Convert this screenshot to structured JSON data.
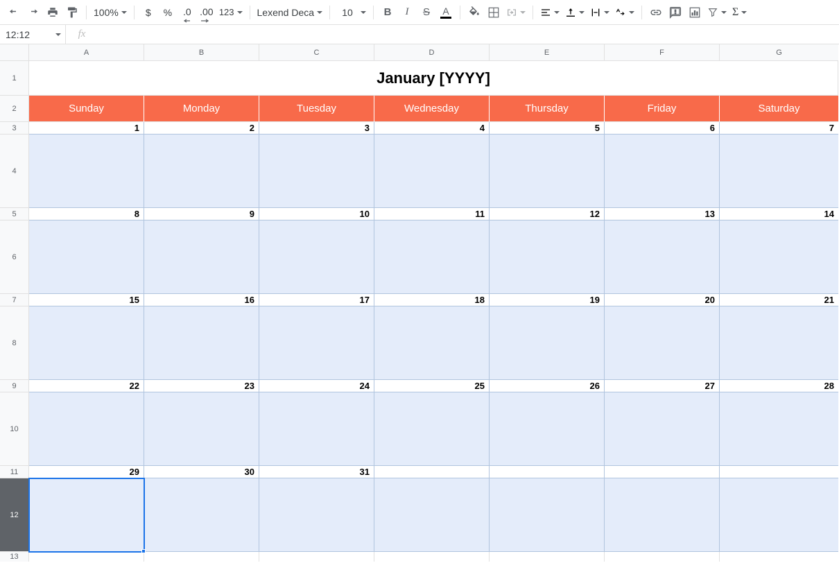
{
  "toolbar": {
    "zoom": "100%",
    "currency": "$",
    "percent": "%",
    "dec_dec": ".0",
    "inc_dec": ".00",
    "num_fmt": "123",
    "font": "Lexend Deca",
    "font_size": "10"
  },
  "namebox": "12:12",
  "fx": "fx",
  "columns": [
    "A",
    "B",
    "C",
    "D",
    "E",
    "F",
    "G"
  ],
  "row_numbers": [
    "1",
    "2",
    "3",
    "4",
    "5",
    "6",
    "7",
    "8",
    "9",
    "10",
    "11",
    "12",
    "13"
  ],
  "title": "January [YYYY]",
  "day_names": [
    "Sunday",
    "Monday",
    "Tuesday",
    "Wednesday",
    "Thursday",
    "Friday",
    "Saturday"
  ],
  "weeks": [
    {
      "dates": [
        "1",
        "2",
        "3",
        "4",
        "5",
        "6",
        "7"
      ]
    },
    {
      "dates": [
        "8",
        "9",
        "10",
        "11",
        "12",
        "13",
        "14"
      ]
    },
    {
      "dates": [
        "15",
        "16",
        "17",
        "18",
        "19",
        "20",
        "21"
      ]
    },
    {
      "dates": [
        "22",
        "23",
        "24",
        "25",
        "26",
        "27",
        "28"
      ]
    },
    {
      "dates": [
        "29",
        "30",
        "31",
        "",
        "",
        "",
        ""
      ]
    }
  ],
  "selected_row": 12
}
